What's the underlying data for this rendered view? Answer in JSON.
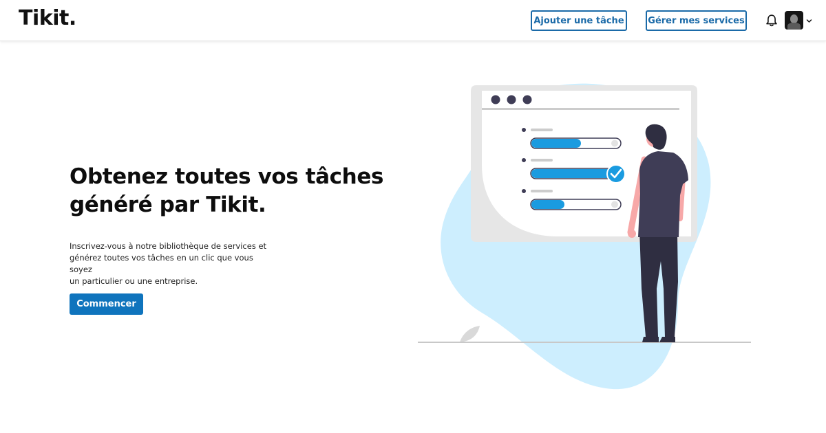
{
  "brand": {
    "logo_text": "Tikit."
  },
  "header": {
    "add_task_label": "Ajouter une tâche",
    "manage_services_label": "Gérer mes services",
    "notification_icon": "bell-icon",
    "avatar_icon": "avatar",
    "menu_icon": "chevron-down-icon"
  },
  "hero": {
    "title_line1": "Obtenez toutes vos tâches",
    "title_line2": "généré par Tikit.",
    "description_line1": "Inscrivez-vous à notre bibliothèque de services et",
    "description_line2": "générez toutes vos tâches en un clic que vous soyez",
    "description_line3": "un particulier ou une entreprise.",
    "cta_label": "Commencer"
  },
  "illustration": {
    "progress_levels": [
      0.55,
      1.0,
      0.37
    ],
    "colors": {
      "accent": "#0f74bd",
      "progress": "#1a9be0",
      "blob": "#cdeefe",
      "figure": "#3b3a4a",
      "skin": "#f7a8a8"
    }
  }
}
